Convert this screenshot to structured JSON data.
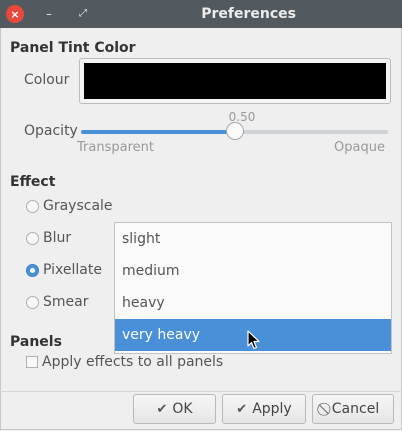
{
  "window": {
    "title": "Preferences",
    "close_icon": "×",
    "min_icon": "–",
    "max_icon": "⤢"
  },
  "panel_tint": {
    "heading": "Panel Tint Color",
    "colour_label": "Colour",
    "colour_value": "#000000",
    "opacity_label": "Opacity",
    "opacity_value": "0.50",
    "opacity_fraction": 0.5,
    "min_label": "Transparent",
    "max_label": "Opaque"
  },
  "effect": {
    "heading": "Effect",
    "options": [
      {
        "label": "Grayscale",
        "checked": false
      },
      {
        "label": "Blur",
        "checked": false
      },
      {
        "label": "Pixellate",
        "checked": true
      },
      {
        "label": "Smear",
        "checked": false
      }
    ],
    "dropdown": {
      "items": [
        "slight",
        "medium",
        "heavy",
        "very heavy"
      ],
      "highlighted": "very heavy"
    }
  },
  "panels": {
    "heading": "Panels",
    "apply_all_label": "Apply effects to all panels",
    "apply_all_checked": false
  },
  "buttons": {
    "ok": "OK",
    "apply": "Apply",
    "cancel": "Cancel"
  },
  "colors": {
    "accent": "#4a90d9",
    "titlebar": "#535a5f",
    "close": "#e74a3c"
  }
}
